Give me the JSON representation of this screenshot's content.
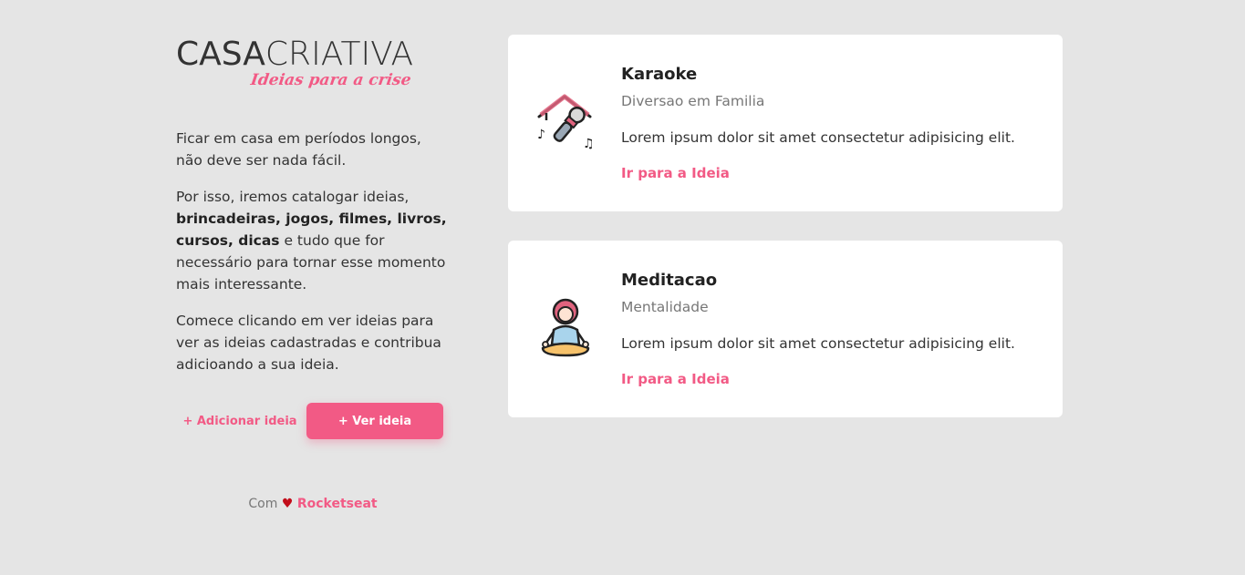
{
  "brand": {
    "logo_part1": "CASA",
    "logo_part2": "CRIATIVA",
    "tagline": "Ideias para a crise"
  },
  "intro": {
    "p1": "Ficar em casa em períodos longos, não deve ser nada fácil.",
    "p2_a": "Por isso, iremos catalogar ideias, ",
    "p2_bold": "brincadeiras, jogos, filmes, livros, cursos, dicas",
    "p2_b": " e tudo que for necessário para tornar esse momento mais interessante.",
    "p3": "Comece clicando em ver ideias para ver as ideias cadastradas e contribua adicioando a sua ideia."
  },
  "actions": {
    "add_label": "+ Adicionar ideia",
    "view_label": "+ Ver ideia"
  },
  "footer": {
    "prefix": "Com",
    "heart": "♥",
    "link": "Rocketseat"
  },
  "ideas": [
    {
      "title": "Karaoke",
      "category": "Diversao em Familia",
      "description": "Lorem ipsum dolor sit amet consectetur adipisicing elit.",
      "link": "Ir para a Ideia",
      "icon": "karaoke-icon"
    },
    {
      "title": "Meditacao",
      "category": "Mentalidade",
      "description": "Lorem ipsum dolor sit amet consectetur adipisicing elit.",
      "link": "Ir para a Ideia",
      "icon": "meditation-icon"
    }
  ],
  "colors": {
    "accent": "#f25a85",
    "background": "#e5e5e5",
    "card": "#ffffff",
    "heart": "#c20d1a"
  }
}
